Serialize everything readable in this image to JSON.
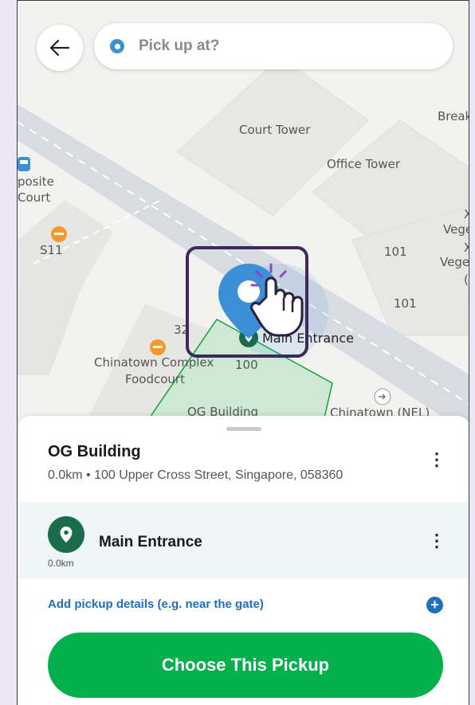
{
  "search": {
    "placeholder": "Pick up at?"
  },
  "map": {
    "labels": {
      "court_tower": "Court Tower",
      "office_tower": "Office Tower",
      "break": "Break",
      "posite": "posite",
      "court": "Court",
      "s11": "S11",
      "n101a": "101",
      "n101b": "101",
      "n32": "32",
      "n100": "100",
      "vege1": "Vege",
      "vege2": "Vege",
      "x1": "X",
      "x2": "X",
      "paren": "(",
      "chinatown_complex": "Chinatown Complex",
      "foodcourt": "Foodcourt",
      "og_building": "OG Building",
      "chinatown_nel": "Chinatown (NEL)",
      "main_entrance": "Main Entrance"
    }
  },
  "sheet": {
    "building_name": "OG Building",
    "building_address": "0.0km • 100 Upper Cross Street, Singapore, 058360",
    "entrance": {
      "name": "Main Entrance",
      "distance": "0.0km"
    },
    "add_details": "Add pickup details (e.g. near the gate)",
    "add_plus": "+",
    "cta": "Choose This Pickup",
    "menu_glyph": "⋮"
  },
  "colors": {
    "accent_green": "#03b04c",
    "entrance_green": "#1b6b4d",
    "link_blue": "#1f6fbf",
    "pin_blue": "#3c8fd6",
    "highlight_box": "#3d2a5c"
  }
}
